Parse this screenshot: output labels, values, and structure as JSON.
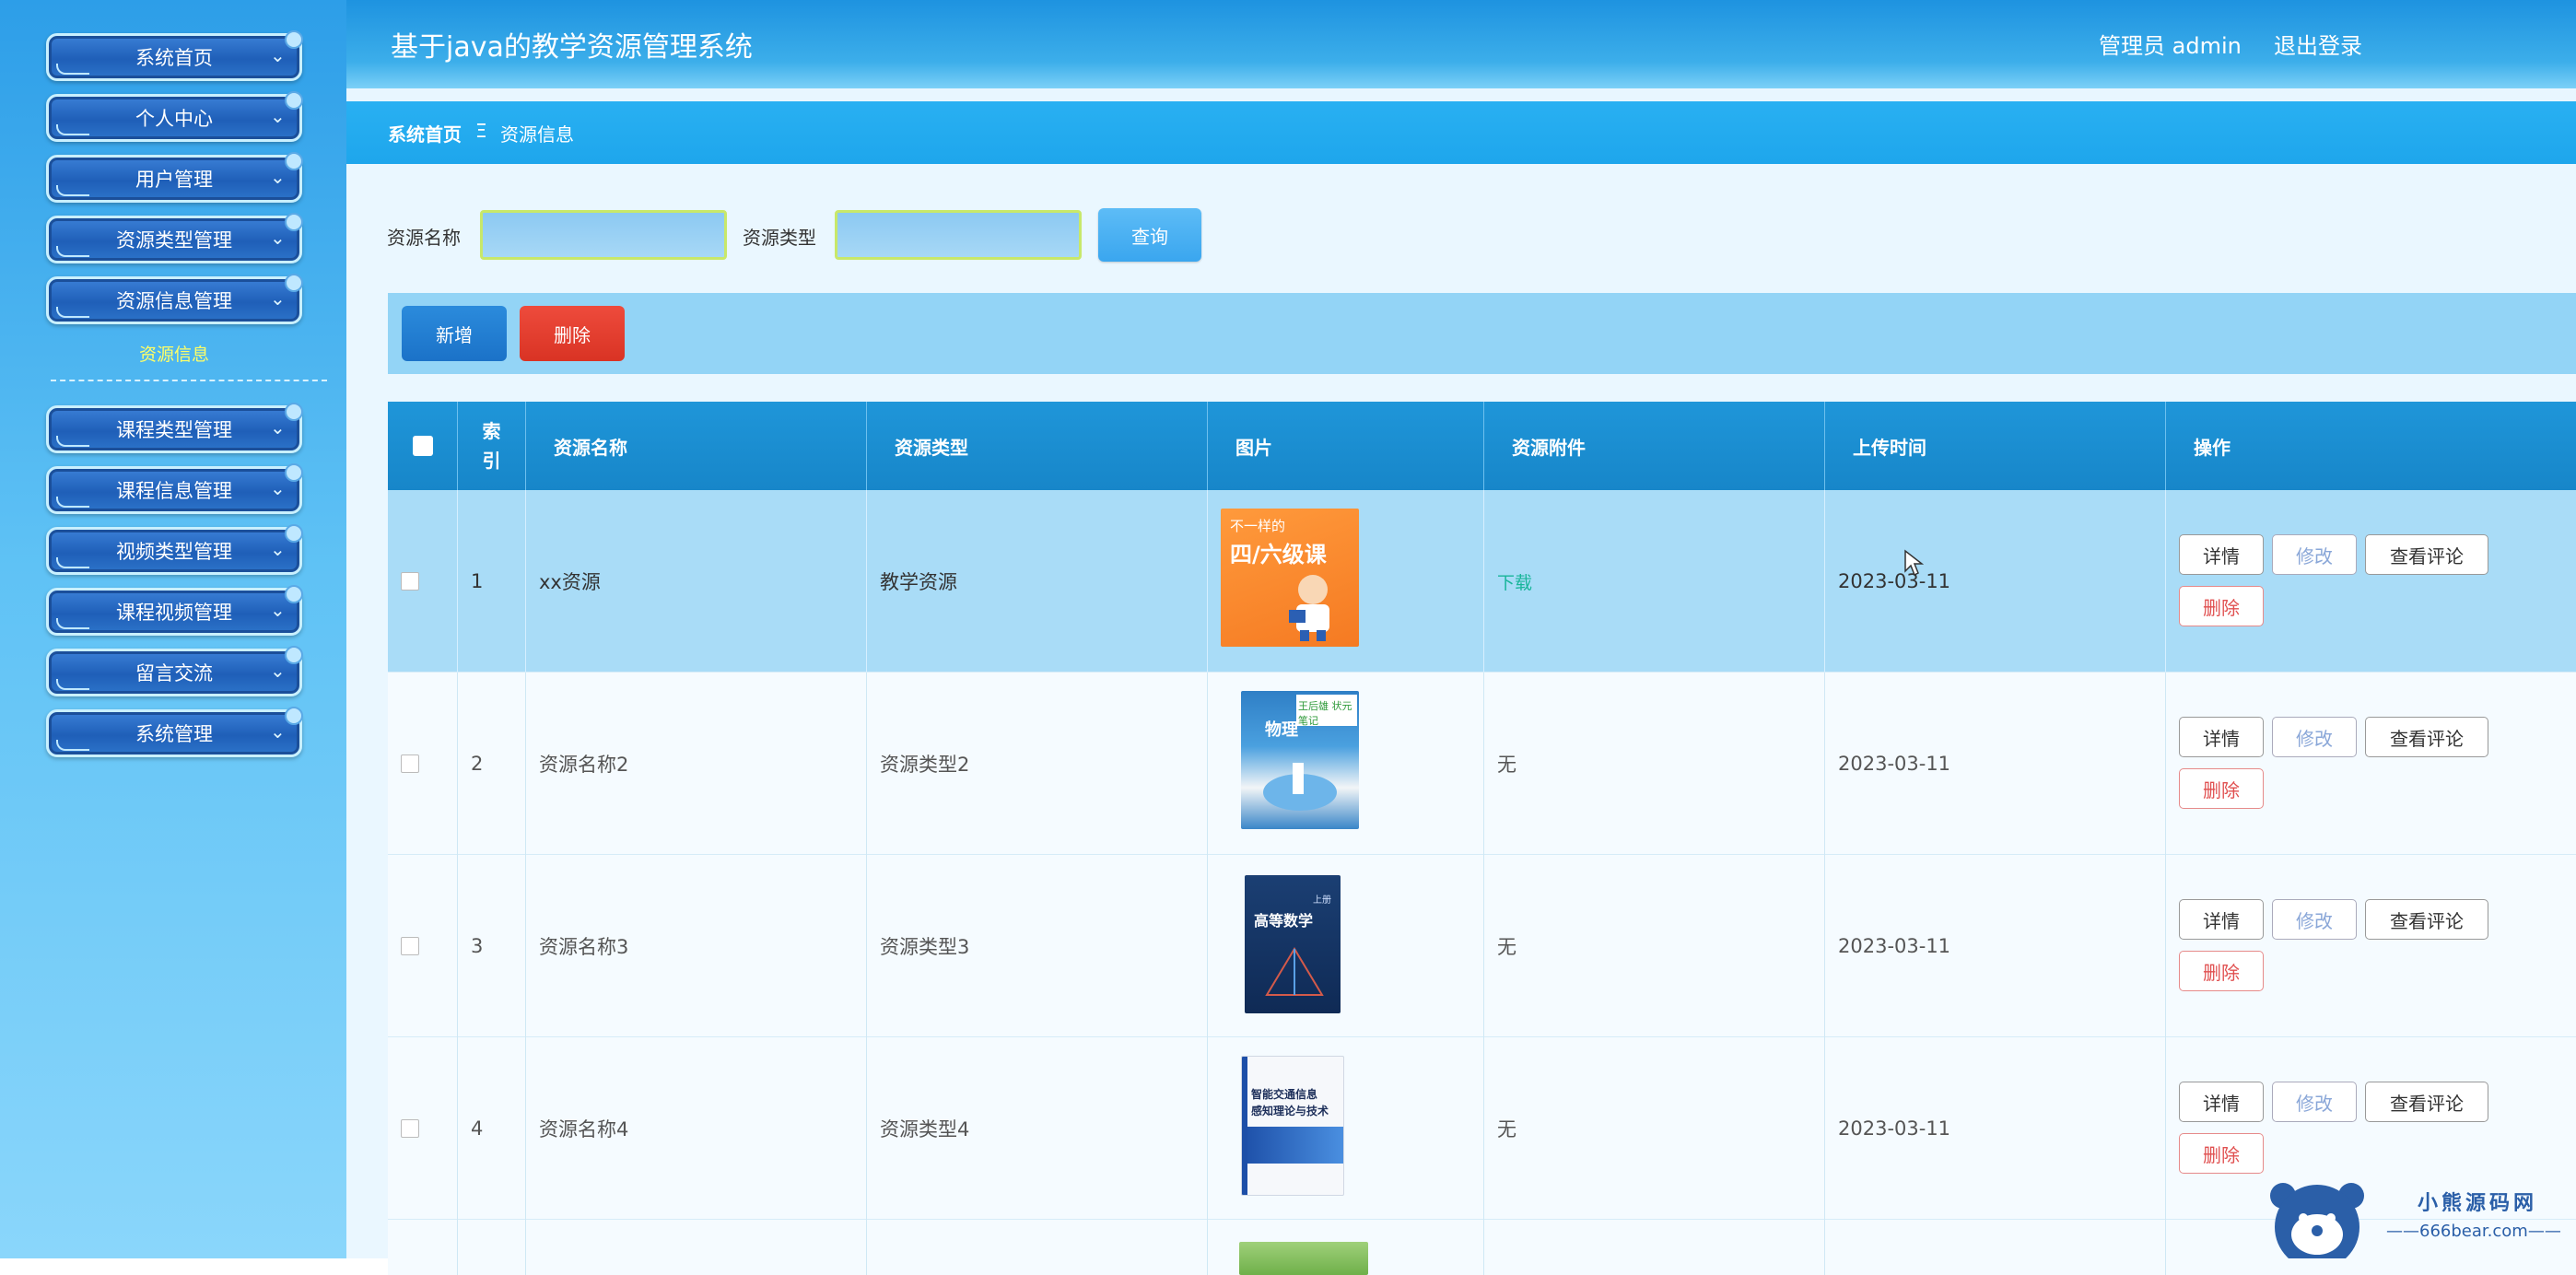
{
  "header": {
    "title": "基于java的教学资源管理系统",
    "user": "管理员 admin",
    "logout": "退出登录"
  },
  "breadcrumb": {
    "home": "系统首页",
    "separator": "Ξ",
    "current": "资源信息"
  },
  "sidebar": {
    "items": [
      {
        "label": "系统首页"
      },
      {
        "label": "个人中心"
      },
      {
        "label": "用户管理"
      },
      {
        "label": "资源类型管理"
      },
      {
        "label": "资源信息管理"
      },
      {
        "label": "课程类型管理"
      },
      {
        "label": "课程信息管理"
      },
      {
        "label": "视频类型管理"
      },
      {
        "label": "课程视频管理"
      },
      {
        "label": "留言交流"
      },
      {
        "label": "系统管理"
      }
    ],
    "active_sub": "资源信息"
  },
  "search": {
    "name_label": "资源名称",
    "name_value": "",
    "type_label": "资源类型",
    "type_value": "",
    "query_button": "查询"
  },
  "toolbar": {
    "add_button": "新增",
    "delete_button": "删除"
  },
  "table": {
    "columns": [
      "索引",
      "资源名称",
      "资源类型",
      "图片",
      "资源附件",
      "上传时间",
      "操作"
    ],
    "index_header_line1": "索",
    "index_header_line2": "引",
    "rows": [
      {
        "index": "1",
        "name": "xx资源",
        "type": "教学资源",
        "attachment": "下载",
        "time": "2023-03-11",
        "cover_text_a": "不一样的",
        "cover_text_b": "四/六级课"
      },
      {
        "index": "2",
        "name": "资源名称2",
        "type": "资源类型2",
        "attachment": "无",
        "time": "2023-03-11",
        "cover_text_a": "物理",
        "cover_text_b": "王后雄 状元笔记"
      },
      {
        "index": "3",
        "name": "资源名称3",
        "type": "资源类型3",
        "attachment": "无",
        "time": "2023-03-11",
        "cover_text_a": "高等数学",
        "cover_text_b": "上册"
      },
      {
        "index": "4",
        "name": "资源名称4",
        "type": "资源类型4",
        "attachment": "无",
        "time": "2023-03-11",
        "cover_text_a": "智能交通信息",
        "cover_text_b": "感知理论与技术"
      }
    ],
    "actions": {
      "detail": "详情",
      "edit": "修改",
      "comments": "查看评论",
      "delete": "删除"
    }
  },
  "watermark": {
    "brand": "小熊源码网",
    "site": "666bear.com"
  },
  "colors": {
    "sidebar_top": "#2d9ee8",
    "header_blue": "#1e93e0",
    "table_header": "#1f96d9",
    "selected_row": "#a9dcf7",
    "delete_red": "#d93324",
    "download_green": "#19b59a"
  }
}
